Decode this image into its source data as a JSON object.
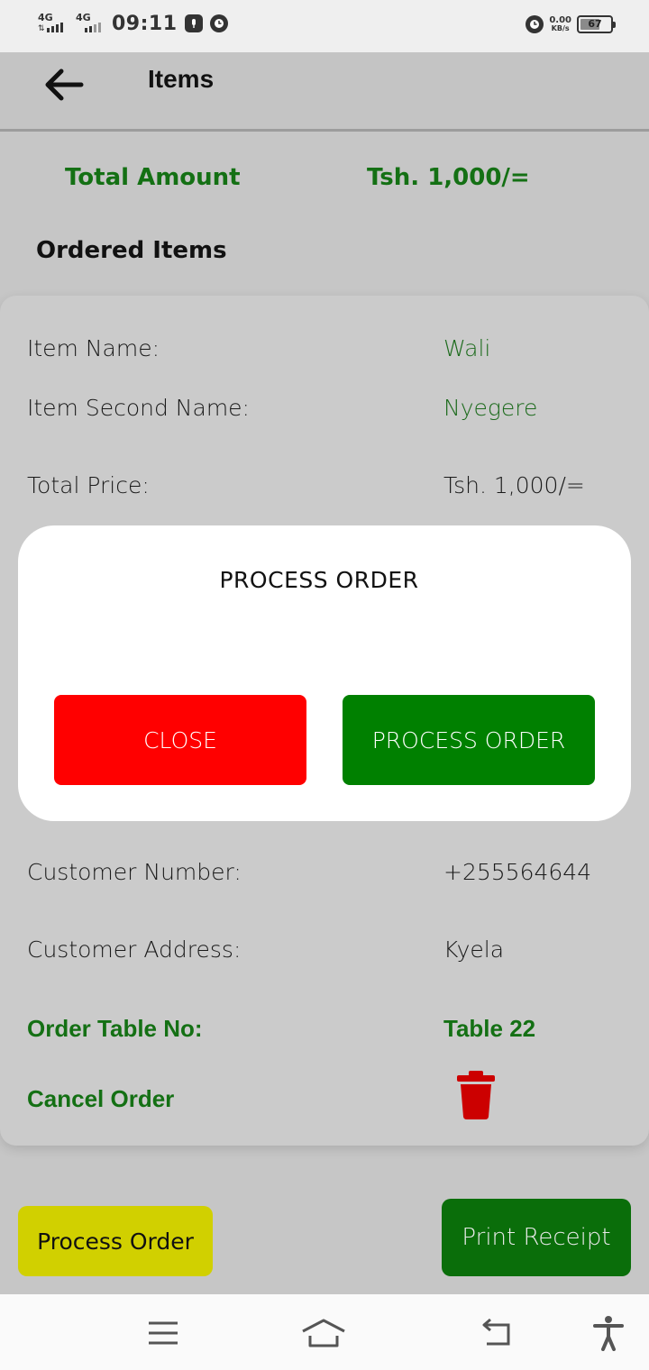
{
  "status_bar": {
    "network_1": "4G",
    "network_2": "4G",
    "time": "09:11",
    "speed_value": "0.00",
    "speed_unit": "KB/s",
    "battery": "67"
  },
  "app_bar": {
    "title": "Items"
  },
  "summary": {
    "total_label": "Total Amount",
    "total_value": "Tsh. 1,000/="
  },
  "ordered_title": "Ordered Items",
  "item": {
    "name_label": "Item Name:",
    "name_value": "Wali",
    "second_name_label": "Item Second Name:",
    "second_name_value": "Nyegere",
    "total_price_label": "Total Price:",
    "total_price_value": "Tsh. 1,000/=",
    "customer_number_label": "Customer Number:",
    "customer_number_value": "+255564644",
    "customer_address_label": "Customer Address:",
    "customer_address_value": "Kyela",
    "table_label": "Order Table No:",
    "table_value": "Table 22",
    "cancel_label": "Cancel Order"
  },
  "bottom_buttons": {
    "process": "Process Order",
    "print": "Print Receipt"
  },
  "dialog": {
    "title": "PROCESS ORDER",
    "close": "CLOSE",
    "process": "PROCESS ORDER"
  },
  "icons": {
    "back": "arrow-left-icon",
    "delete": "trash-icon",
    "nav": [
      "menu-icon",
      "home-icon",
      "back-icon",
      "accessibility-icon"
    ]
  },
  "colors": {
    "accent_green": "#147014",
    "delete_red": "#cc0000",
    "close_red": "#ff0000",
    "process_green": "#008000",
    "process_yellow": "#d1d000",
    "print_green": "#0a6e0a"
  }
}
